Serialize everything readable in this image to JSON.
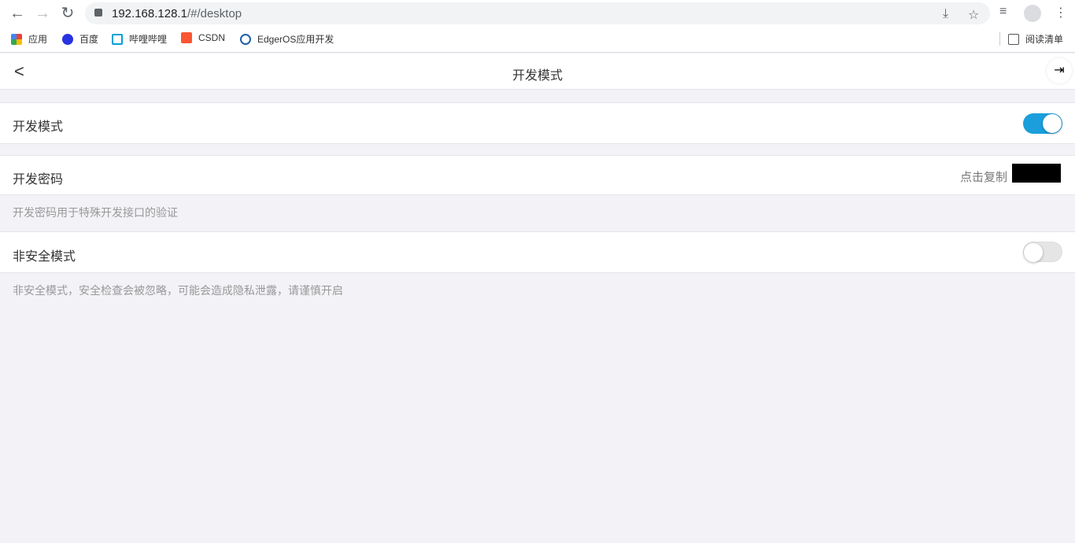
{
  "browser": {
    "url_host": "192.168.128.1",
    "url_path": "/#/desktop",
    "bookmarks": [
      {
        "label": "应用",
        "color": "#e94235"
      },
      {
        "label": "百度",
        "color": "#2932e1"
      },
      {
        "label": "哔哩哔哩",
        "color": "#00a1d6"
      },
      {
        "label": "CSDN",
        "color": "#fc5531"
      },
      {
        "label": "EdgerOS应用开发",
        "color": "#1f5fa8"
      }
    ],
    "reading_list": "阅读清单"
  },
  "header": {
    "title": "开发模式"
  },
  "settings": {
    "dev_mode": {
      "label": "开发模式",
      "enabled": true
    },
    "dev_password": {
      "label": "开发密码",
      "action": "点击复制",
      "note": "开发密码用于特殊开发接口的验证"
    },
    "insecure_mode": {
      "label": "非安全模式",
      "enabled": false,
      "note": "非安全模式，安全检查会被忽略，可能会造成隐私泄露，请谨慎开启"
    }
  },
  "colors": {
    "accent": "#1a9fdc",
    "off": "#e0e0e0"
  }
}
